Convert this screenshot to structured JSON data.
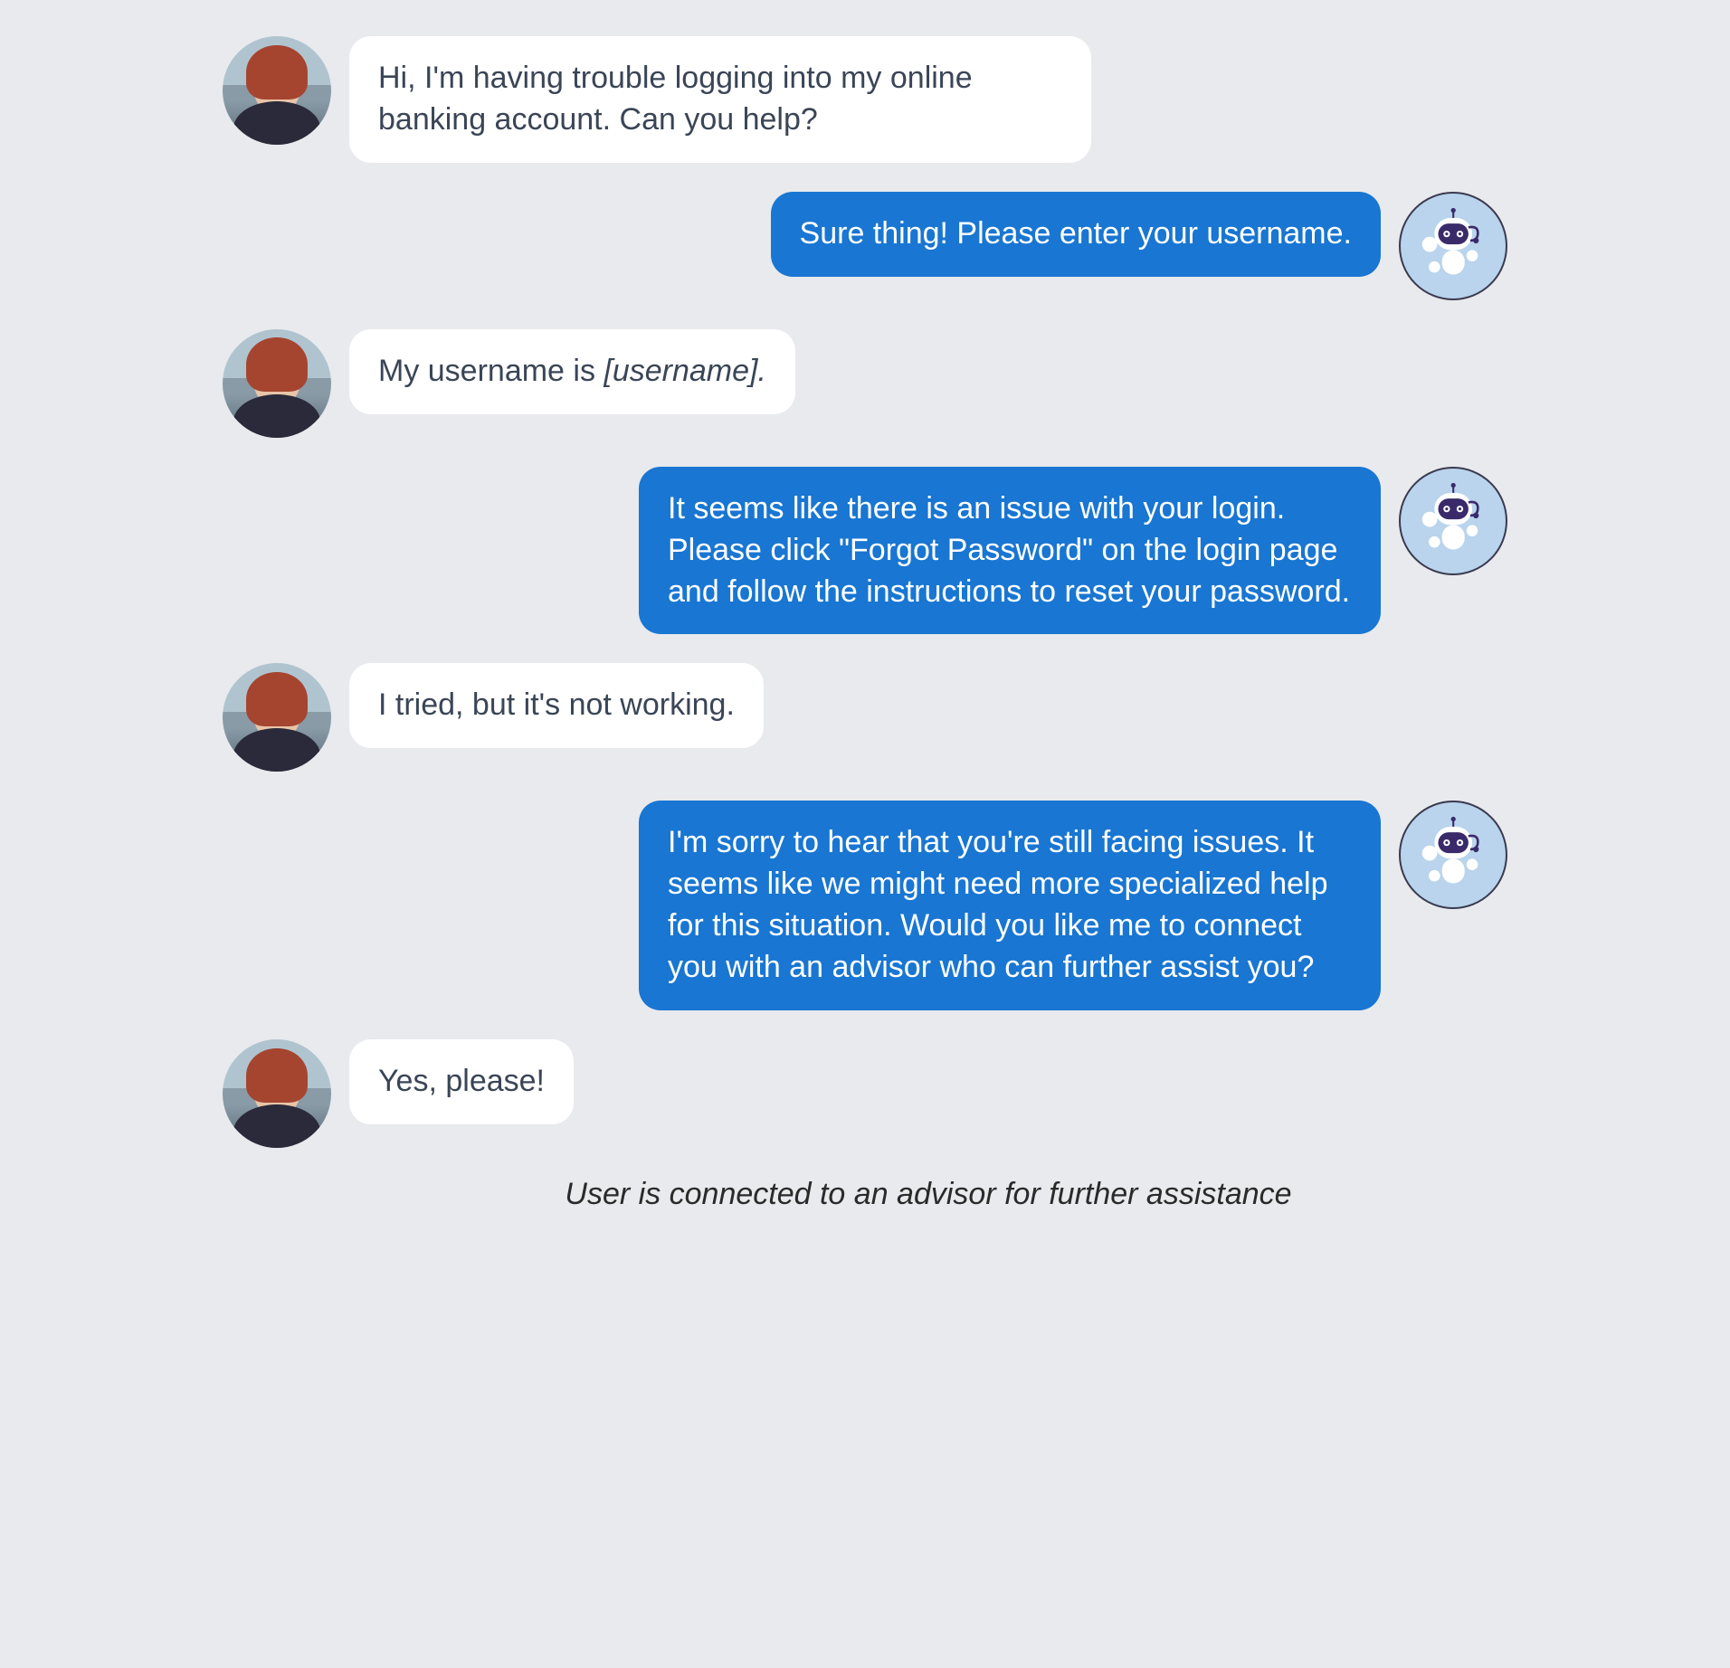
{
  "messages": [
    {
      "sender": "user",
      "text": "Hi, I'm having trouble logging into my online banking account. Can you help?",
      "hasAvatar": true
    },
    {
      "sender": "bot",
      "text": "Sure thing! Please enter your username.",
      "hasAvatar": true
    },
    {
      "sender": "user",
      "prefix": "My username is ",
      "italic": "[username].",
      "hasAvatar": true
    },
    {
      "sender": "bot",
      "text": "It seems like there is an issue with your login. Please click \"Forgot Password\" on the login page and follow the instructions to reset your password.",
      "hasAvatar": true
    },
    {
      "sender": "user",
      "text": "I tried, but it's not working.",
      "hasAvatar": true
    },
    {
      "sender": "bot",
      "text": "I'm sorry to hear that you're still facing issues. It seems like we might need more specialized help for this situation. Would you like me to connect you with an advisor who can further assist you?",
      "hasAvatar": true
    },
    {
      "sender": "user",
      "text": "Yes, please!",
      "hasAvatar": true
    }
  ],
  "systemMessage": "User is connected to an advisor for further assistance",
  "avatars": {
    "user": "user-avatar-icon",
    "bot": "robot-avatar-icon"
  },
  "colors": {
    "userBubble": "#ffffff",
    "botBubble": "#1976d2",
    "background": "#e8eaed"
  }
}
